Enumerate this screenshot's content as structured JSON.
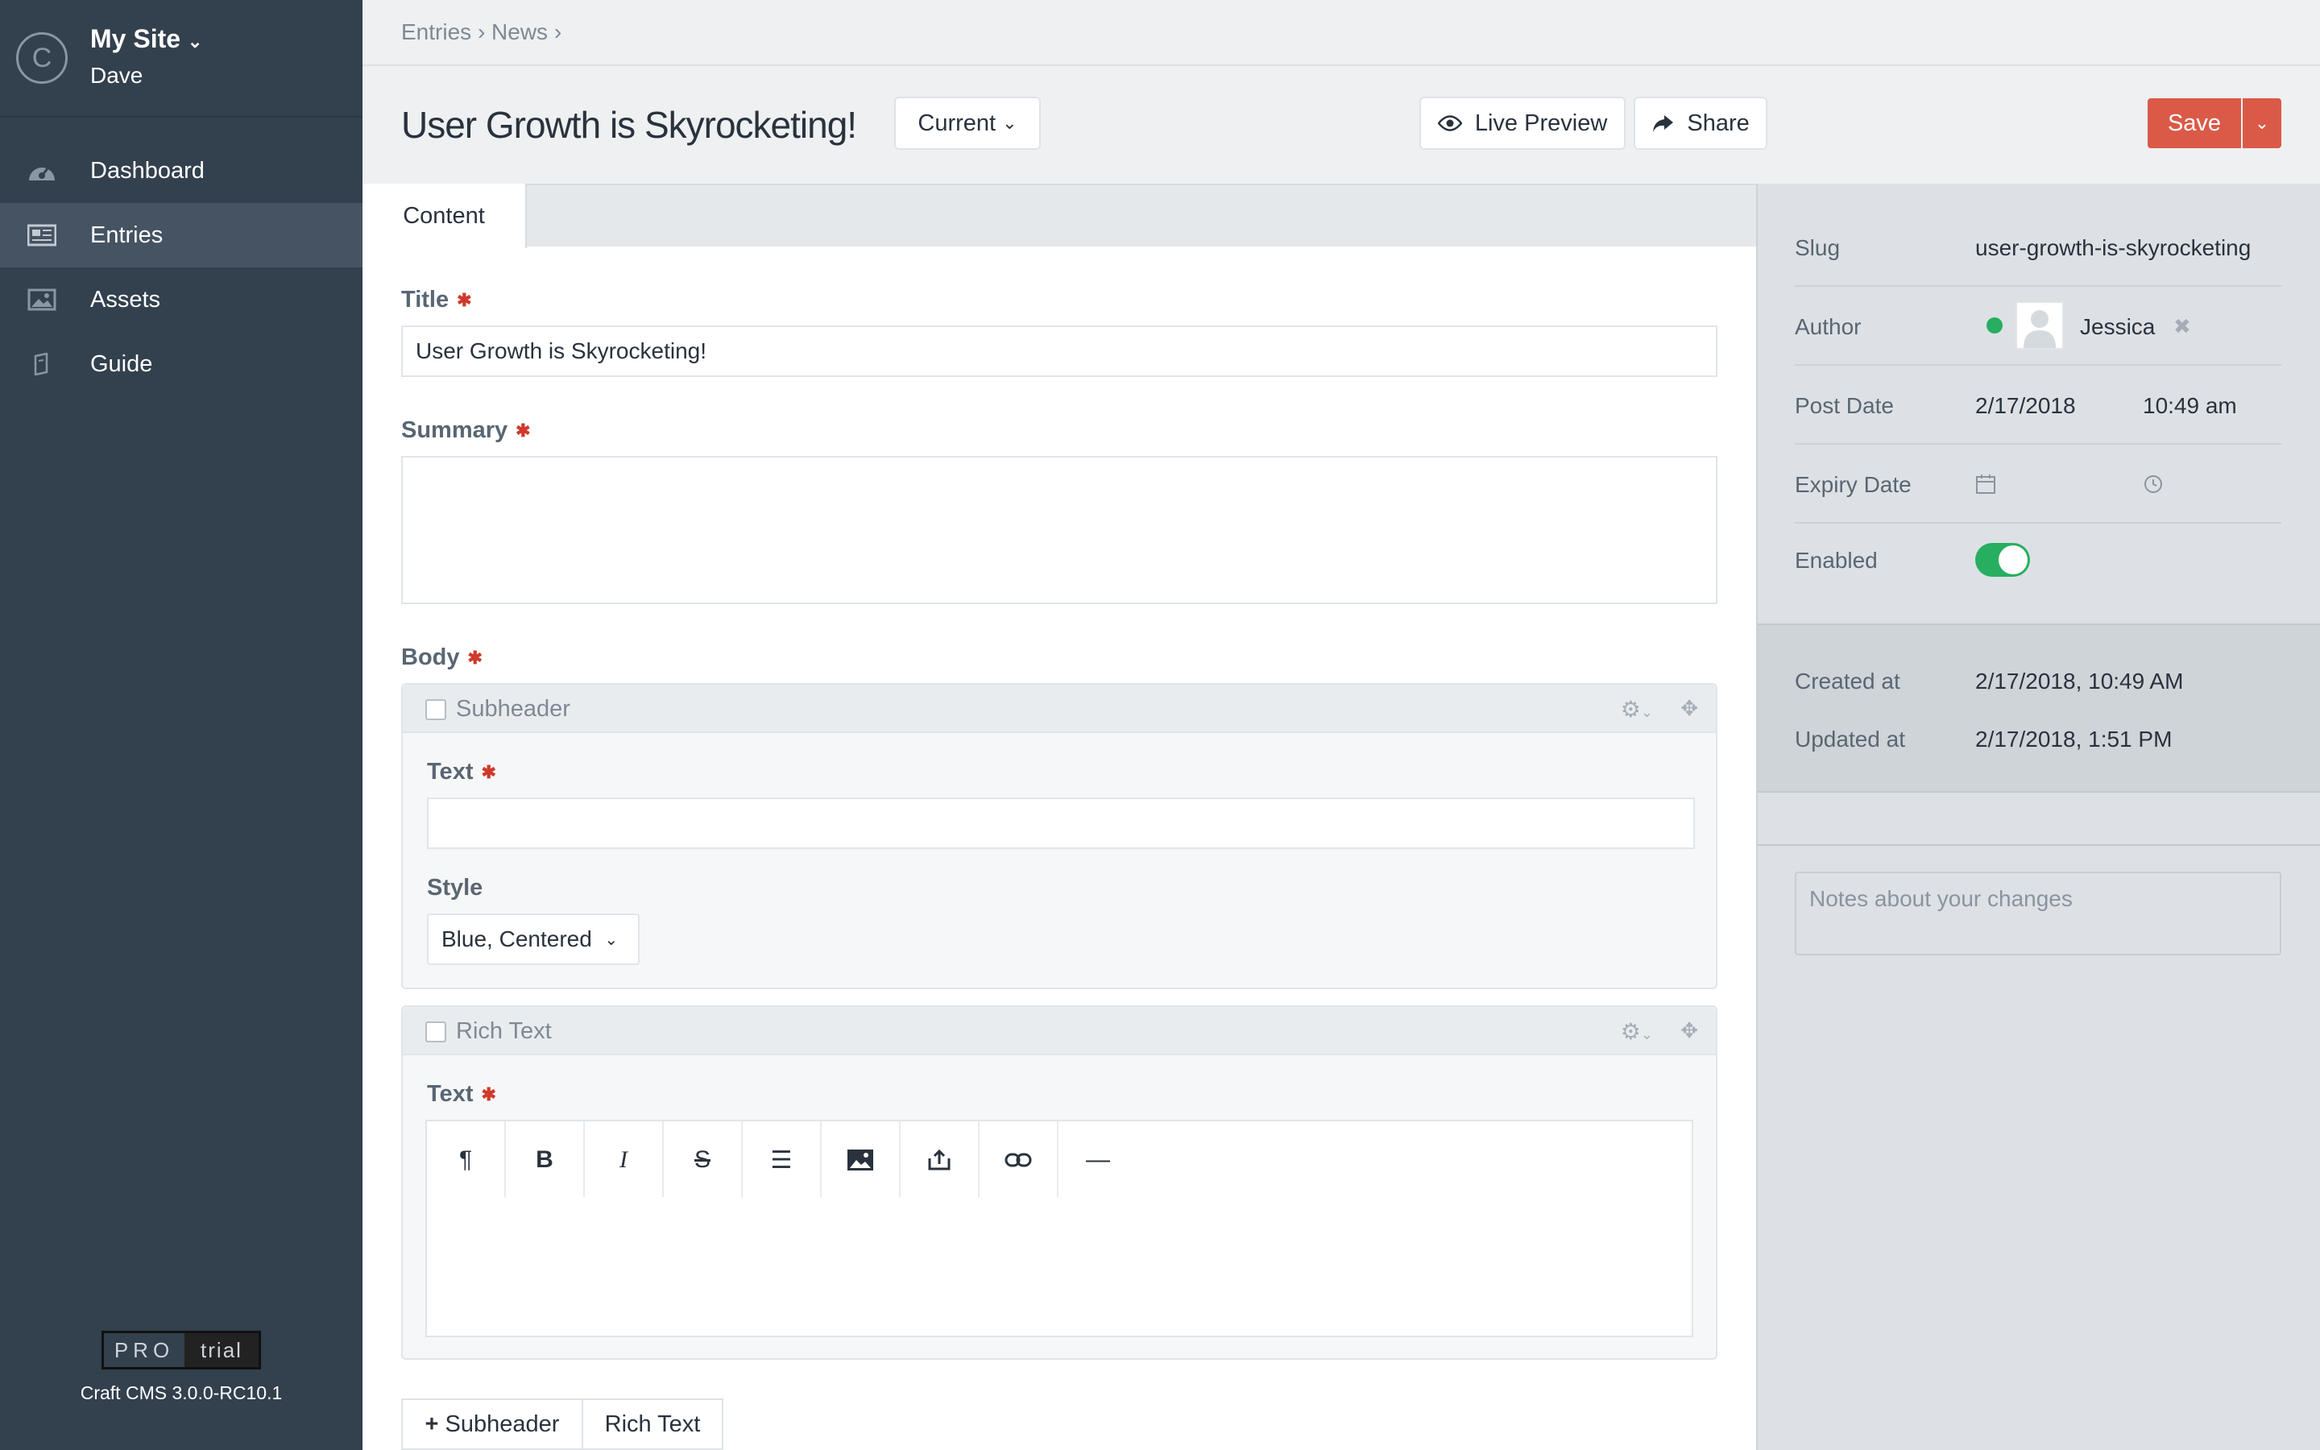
{
  "sidebar": {
    "logo_letter": "C",
    "site_name": "My Site",
    "user": "Dave",
    "items": [
      {
        "label": "Dashboard",
        "icon": "dashboard-icon"
      },
      {
        "label": "Entries",
        "icon": "entries-icon"
      },
      {
        "label": "Assets",
        "icon": "assets-icon"
      },
      {
        "label": "Guide",
        "icon": "guide-icon"
      }
    ],
    "active_item": "Entries",
    "edition": {
      "pro": "PRO",
      "trial": "trial"
    },
    "version": "Craft CMS 3.0.0-RC10.1"
  },
  "breadcrumb": [
    "Entries",
    "News"
  ],
  "header": {
    "title": "User Growth is Skyrocketing!",
    "revision": "Current",
    "live_preview": "Live Preview",
    "share": "Share",
    "save": "Save"
  },
  "tabs": [
    {
      "label": "Content"
    }
  ],
  "fields": {
    "title": {
      "label": "Title",
      "value": "User Growth is Skyrocketing!"
    },
    "summary": {
      "label": "Summary",
      "value": ""
    },
    "body": {
      "label": "Body",
      "blocks": [
        {
          "type": "Subheader",
          "text_label": "Text",
          "text_value": "",
          "style_label": "Style",
          "style_value": "Blue, Centered"
        },
        {
          "type": "Rich Text",
          "text_label": "Text",
          "toolbar": [
            "paragraph-icon",
            "bold-icon",
            "italic-icon",
            "strikethrough-icon",
            "list-icon",
            "image-icon",
            "upload-icon",
            "link-icon",
            "horizontal-rule-icon"
          ]
        }
      ],
      "add_buttons": [
        "Subheader",
        "Rich Text"
      ]
    }
  },
  "meta": {
    "slug_label": "Slug",
    "slug": "user-growth-is-skyrocketing",
    "author_label": "Author",
    "author": "Jessica",
    "post_date_label": "Post Date",
    "post_date": "2/17/2018",
    "post_time": "10:49 am",
    "expiry_label": "Expiry Date",
    "enabled_label": "Enabled",
    "enabled": true,
    "created_label": "Created at",
    "created": "2/17/2018, 10:49 AM",
    "updated_label": "Updated at",
    "updated": "2/17/2018, 1:51 PM",
    "notes_placeholder": "Notes about your changes"
  },
  "colors": {
    "accent": "#da5a47",
    "sidebar": "#33404d",
    "enabled": "#27ae60"
  }
}
